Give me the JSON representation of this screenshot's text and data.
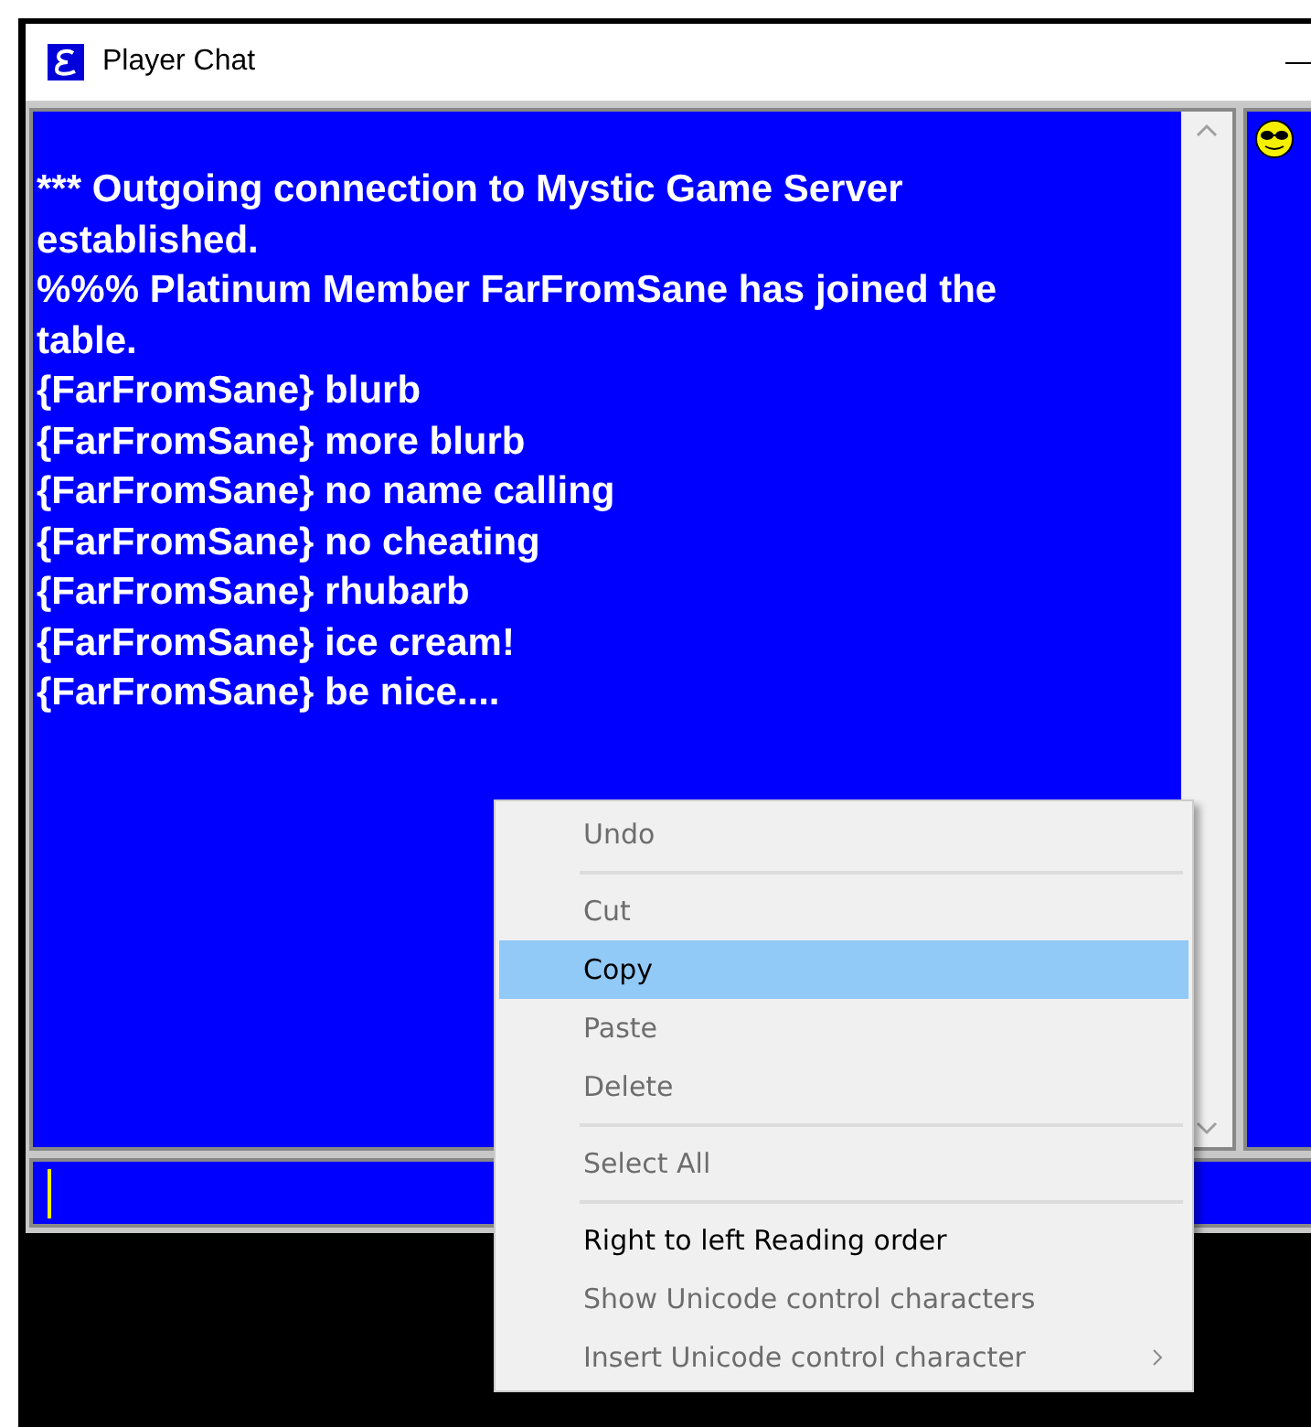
{
  "window": {
    "title": "Player Chat"
  },
  "messages": [
    "*** Outgoing connection to Mystic Game Server established.",
    "%%% Platinum Member FarFromSane has joined the table.",
    "{FarFromSane} blurb",
    "{FarFromSane} more blurb",
    "{FarFromSane} no name calling",
    "{FarFromSane} no cheating",
    "{FarFromSane} rhubarb",
    "{FarFromSane} ice cream!",
    "{FarFromSane} be nice...."
  ],
  "context_menu": {
    "groups": [
      [
        {
          "label": "Undo",
          "disabled": true,
          "selected": false,
          "submenu": false
        }
      ],
      [
        {
          "label": "Cut",
          "disabled": true,
          "selected": false,
          "submenu": false
        },
        {
          "label": "Copy",
          "disabled": false,
          "selected": true,
          "submenu": false
        },
        {
          "label": "Paste",
          "disabled": true,
          "selected": false,
          "submenu": false
        },
        {
          "label": "Delete",
          "disabled": true,
          "selected": false,
          "submenu": false
        }
      ],
      [
        {
          "label": "Select All",
          "disabled": true,
          "selected": false,
          "submenu": false
        }
      ],
      [
        {
          "label": "Right to left Reading order",
          "disabled": false,
          "selected": false,
          "submenu": false
        },
        {
          "label": "Show Unicode control characters",
          "disabled": true,
          "selected": false,
          "submenu": false
        },
        {
          "label": "Insert Unicode control character",
          "disabled": true,
          "selected": false,
          "submenu": true
        }
      ]
    ]
  }
}
